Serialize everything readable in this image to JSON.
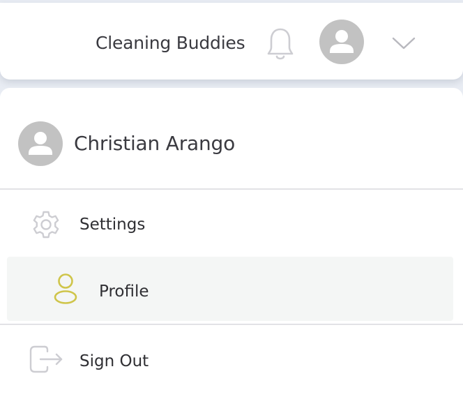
{
  "header": {
    "company_name": "Cleaning Buddies",
    "notification_icon": "bell-icon",
    "avatar_icon": "user-avatar-icon",
    "menu_toggle_icon": "chevron-down-icon"
  },
  "dropdown": {
    "user": {
      "name": "Christian Arango",
      "avatar_icon": "user-avatar-icon"
    },
    "items": [
      {
        "label": "Settings",
        "icon": "gear-icon",
        "active": false
      },
      {
        "label": "Profile",
        "icon": "user-icon",
        "active": true
      },
      {
        "label": "Sign Out",
        "icon": "sign-out-icon",
        "active": false
      }
    ]
  },
  "colors": {
    "active_icon": "#cfc54a",
    "inactive_icon": "#cdcdd2",
    "active_background": "#f4f6f5",
    "avatar_background": "#c2c2c2"
  }
}
